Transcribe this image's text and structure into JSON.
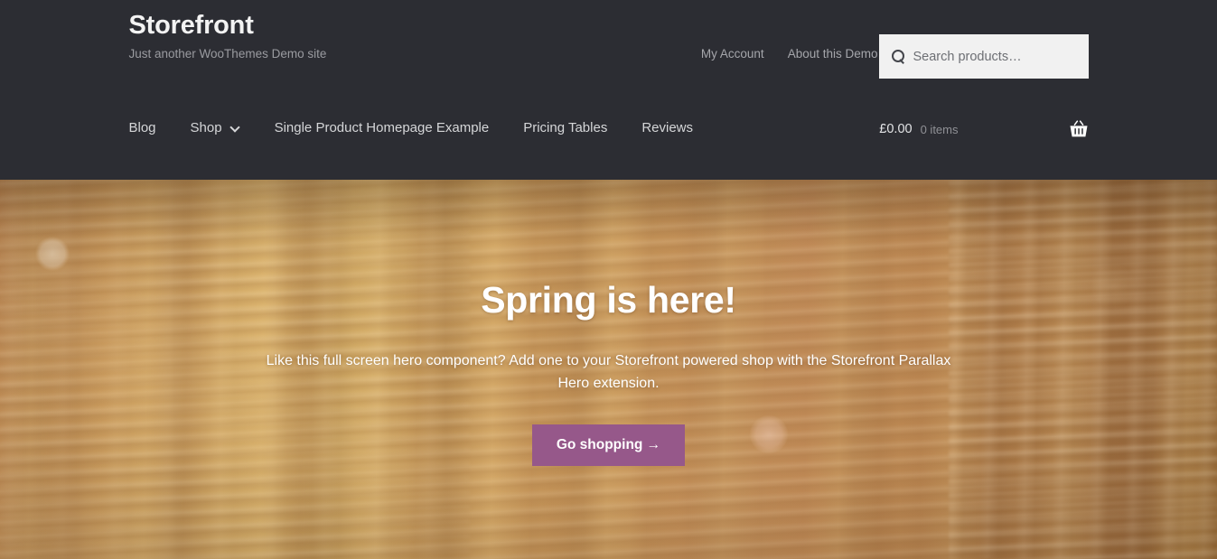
{
  "site": {
    "title": "Storefront",
    "description": "Just another WooThemes Demo site",
    "header_bg": "#2c2d33",
    "accent": "#96588a"
  },
  "secondary_nav": {
    "items": [
      {
        "label": "My Account"
      },
      {
        "label": "About this Demo"
      }
    ]
  },
  "search": {
    "placeholder": "Search products…",
    "value": "",
    "icon": "search-icon"
  },
  "primary_nav": {
    "items": [
      {
        "label": "Blog",
        "has_dropdown": false
      },
      {
        "label": "Shop",
        "has_dropdown": true
      },
      {
        "label": "Single Product Homepage Example",
        "has_dropdown": false
      },
      {
        "label": "Pricing Tables",
        "has_dropdown": false
      },
      {
        "label": "Reviews",
        "has_dropdown": false
      }
    ]
  },
  "cart": {
    "amount": "£0.00",
    "count": "0 items",
    "icon": "shopping-basket-icon"
  },
  "hero": {
    "title": "Spring is here!",
    "text": "Like this full screen hero component? Add one to your Storefront powered shop with the Storefront Parallax Hero extension.",
    "button_label": "Go shopping →"
  }
}
